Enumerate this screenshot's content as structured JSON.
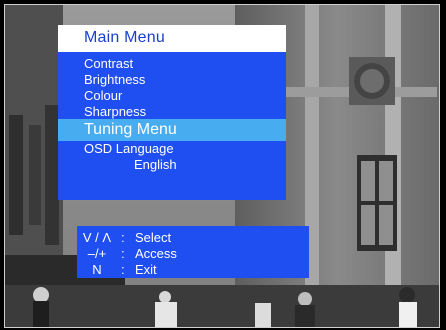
{
  "menu": {
    "title": "Main Menu",
    "items": [
      {
        "label": "Contrast"
      },
      {
        "label": "Brightness"
      },
      {
        "label": "Colour"
      },
      {
        "label": "Sharpness"
      },
      {
        "label": "Tuning Menu",
        "selected": true
      },
      {
        "label": "OSD Language"
      },
      {
        "label": "English"
      }
    ]
  },
  "help": {
    "rows": [
      {
        "key": "V / Λ",
        "separator": ":",
        "action": "Select"
      },
      {
        "key": "–/+",
        "separator": ":",
        "action": "Access"
      },
      {
        "key": "N",
        "separator": ":",
        "action": "Exit"
      }
    ]
  },
  "colors": {
    "panel": "#1f4ff0",
    "highlight": "#47acf0",
    "title_bar": "#ffffff",
    "title_text": "#1a3fd0"
  }
}
